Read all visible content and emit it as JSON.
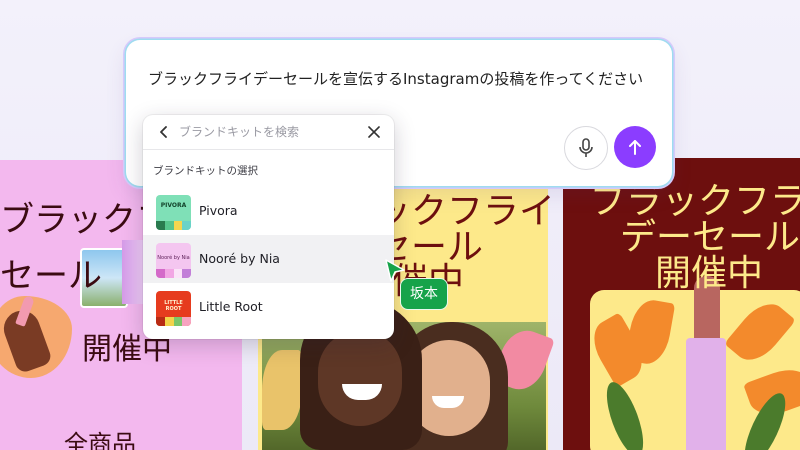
{
  "prompt": {
    "text": "ブラックフライデーセールを宣伝するInstagramの投稿を作ってください"
  },
  "brand_picker": {
    "search_placeholder": "ブランドキットを検索",
    "heading": "ブランドキットの選択",
    "items": [
      {
        "label": "Pivora",
        "logo_text": "PIVORA",
        "logo_bg": "#7fe0b7",
        "stripes": [
          "#2a7a4f",
          "#57c58d",
          "#f4d64f",
          "#6ad3c8"
        ]
      },
      {
        "label": "Nooré by Nia",
        "logo_text": "Nooré by Nia",
        "logo_bg": "#f4c6f0",
        "stripes": [
          "#d46ac9",
          "#f2a6e4",
          "#fbe3f8",
          "#c27fd8"
        ]
      },
      {
        "label": "Little Root",
        "logo_text": "LITTLE ROOT",
        "logo_bg": "#e63b1e",
        "stripes": [
          "#b82b14",
          "#f3d34a",
          "#7bc66a",
          "#f7a3c0"
        ]
      }
    ],
    "selected_index": 1
  },
  "collaborator": {
    "name": "坂本",
    "color": "#16a34a"
  },
  "designs": {
    "left": {
      "line1": "ブラックフライ",
      "line2": "セール",
      "open": "開催中",
      "all_items": "全商品"
    },
    "middle": {
      "line1": "ックフライ",
      "line2": "セール",
      "line3": "催中"
    },
    "right": {
      "line1": "ブラックフラ",
      "line2": "デーセール",
      "line3": "開催中"
    }
  },
  "colors": {
    "accent": "#8b3dff"
  }
}
